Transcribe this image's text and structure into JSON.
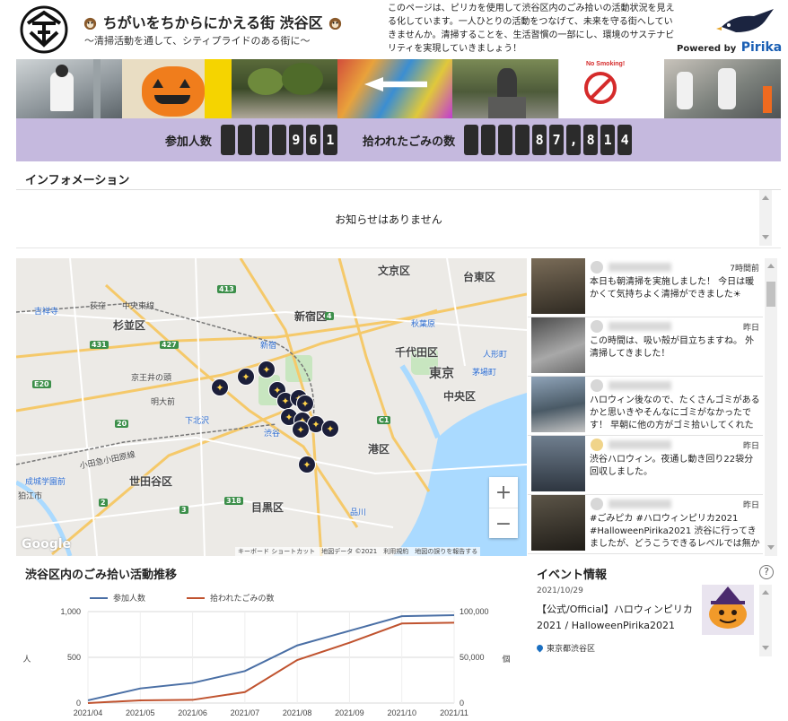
{
  "header": {
    "title": "ちがいをちからにかえる街 渋谷区",
    "subtitle": "〜清掃活動を通して、シティプライドのある街に〜",
    "description": "このページは、ピリカを使用して渋谷区内のごみ拾いの活動状況を見える化しています。一人ひとりの活動をつなげて、未来を守る街へしていきませんか。清掃することを、生活習慣の一部にし、環境のサステナビリティを実現していきましょう！",
    "powered_by": "Powered by",
    "brand": "Pirika"
  },
  "counter": {
    "participants_label": "参加人数",
    "participants_digits": [
      "",
      "",
      "",
      "",
      "9",
      "6",
      "1"
    ],
    "litter_label": "拾われたごみの数",
    "litter_digits": [
      "",
      "",
      "",
      "",
      "8",
      "7",
      ",",
      "8",
      "1",
      "4"
    ]
  },
  "info": {
    "title": "インフォメーション",
    "message": "お知らせはありません"
  },
  "map": {
    "wards": [
      {
        "name": "文京区",
        "size": "big"
      },
      {
        "name": "台東区",
        "size": "big"
      },
      {
        "name": "杉並区",
        "size": "big"
      },
      {
        "name": "新宿区",
        "size": "big"
      },
      {
        "name": "千代田区",
        "size": "big"
      },
      {
        "name": "東京",
        "size": "big"
      },
      {
        "name": "中央区",
        "size": "big"
      },
      {
        "name": "港区",
        "size": "big"
      },
      {
        "name": "世田谷区",
        "size": "big"
      },
      {
        "name": "目黒区",
        "size": "big"
      }
    ],
    "stations": [
      "吉祥寺",
      "荻窪",
      "中央東線",
      "京王井の頭",
      "明大前",
      "下北沢",
      "新宿",
      "秋葉原",
      "人形町",
      "茅場町",
      "小田急小田原線",
      "成城学園前",
      "狛江市",
      "渋谷",
      "品川"
    ],
    "route_numbers": [
      "427",
      "413",
      "431",
      "318",
      "4",
      "20",
      "3",
      "E20",
      "C1",
      "2"
    ],
    "zoom_in": "+",
    "zoom_out": "−",
    "google": "Google",
    "attribution": "キーボード ショートカット　地図データ ©2021　利用規約　地図の誤りを報告する"
  },
  "feed": {
    "posts": [
      {
        "time": "7時間前",
        "text": "本日も朝清掃を実施しました！ 今日は暖かくて気持ちよく清掃ができました☀"
      },
      {
        "time": "昨日",
        "text": "この時間は、吸い殻が目立ちますね。 外清掃してきました！"
      },
      {
        "time": "",
        "text": "ハロウィン後なので、たくさんゴミがあるかと思いきやそんなにゴミがなかったです！ 早朝に他の方がゴミ拾いしてくれた"
      },
      {
        "time": "昨日",
        "text": "渋谷ハロウィン。夜通し動き回り22袋分回収しました。"
      },
      {
        "time": "昨日",
        "text": "#ごみピカ #ハロウィンピリカ2021 #HalloweenPirika2021 渋谷に行ってきましたが、どうこうできるレベルでは無かっ"
      }
    ]
  },
  "chart_title": "渋谷区内のごみ拾い活動推移",
  "chart_data": {
    "type": "line",
    "x": [
      "2021/04",
      "2021/05",
      "2021/06",
      "2021/07",
      "2021/08",
      "2021/09",
      "2021/10",
      "2021/11"
    ],
    "series": [
      {
        "name": "参加人数",
        "axis": "left",
        "color": "#4a6fa5",
        "values": [
          30,
          160,
          220,
          350,
          630,
          790,
          950,
          961
        ]
      },
      {
        "name": "拾われたごみの数",
        "axis": "right",
        "color": "#c0532f",
        "values": [
          0,
          3000,
          3500,
          12000,
          47000,
          66000,
          87000,
          87814
        ]
      }
    ],
    "left_axis": {
      "label": "人",
      "ticks": [
        "0",
        "500",
        "1,000"
      ],
      "ylim": [
        0,
        1000
      ]
    },
    "right_axis": {
      "label": "個",
      "ticks": [
        "0",
        "50,000",
        "100,000"
      ],
      "ylim": [
        0,
        100000
      ]
    },
    "legend_position": "top-left"
  },
  "events": {
    "title": "イベント情報",
    "help": "?",
    "date": "2021/10/29",
    "name": "【公式/Official】ハロウィンピリカ2021 / HalloweenPirika2021",
    "location": "東京都渋谷区"
  },
  "colors": {
    "band": "#c5b9de",
    "series_people": "#4a6fa5",
    "series_litter": "#c0532f"
  }
}
